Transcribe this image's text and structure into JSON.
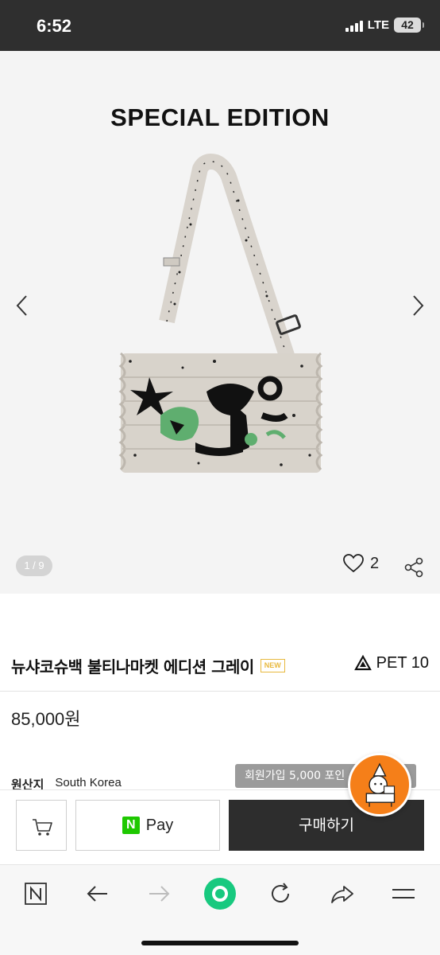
{
  "status_bar": {
    "time": "6:52",
    "network": "LTE",
    "battery": "42"
  },
  "gallery": {
    "banner_text": "SPECIAL EDITION",
    "image_counter": "1 / 9",
    "like_count": "2"
  },
  "product": {
    "title": "뉴샤코슈백 불티나마켓 에디션 그레이",
    "badge": "NEW",
    "pet_label": "PET 10",
    "price": "85,000원",
    "origin_label": "원산지",
    "origin_value": "South Korea"
  },
  "tooltip": {
    "text": "회원가입 5,000 포인"
  },
  "buy_bar": {
    "npay_logo": "N",
    "npay_label": "Pay",
    "purchase_label": "구매하기"
  },
  "colors": {
    "status_bar": "#2f2f2f",
    "gallery_bg": "#f4f4f4",
    "purchase_bg": "#2d2d2d",
    "npay_green": "#1ec800",
    "mascot_orange": "#f57f19",
    "active_green": "#18c97f",
    "badge_gold": "#e8b93e"
  },
  "icons": {
    "cart": "cart-icon",
    "like": "heart-icon",
    "share": "share-icon",
    "prev": "chevron-left-icon",
    "next": "chevron-right-icon",
    "toolbar": [
      "naver-n-icon",
      "back-arrow-icon",
      "forward-arrow-icon",
      "green-dot-icon",
      "refresh-icon",
      "share-arrow-icon",
      "menu-icon"
    ]
  }
}
